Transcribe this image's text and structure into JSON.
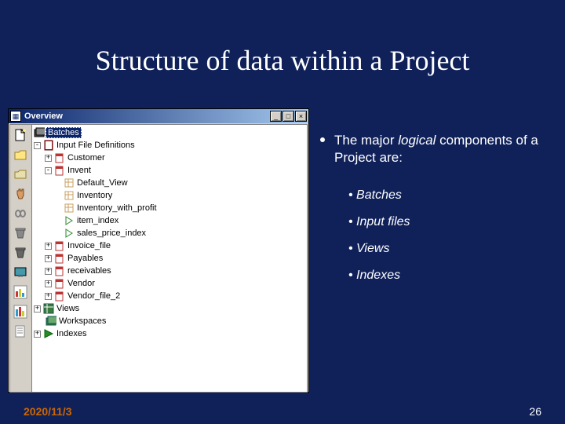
{
  "slide": {
    "title": "Structure of data within a Project",
    "date": "2020/11/3",
    "page_number": "26"
  },
  "overview_window": {
    "title": "Overview",
    "buttons": {
      "minimize": "_",
      "maximize": "□",
      "close": "×"
    }
  },
  "toolbar_icons": [
    "new-file-icon",
    "open-folder-icon",
    "folder-icon",
    "hand-icon",
    "link-icon",
    "bin-icon",
    "trash-icon",
    "monitor-icon",
    "bar-chart-icon",
    "column-chart-icon",
    "report-icon"
  ],
  "tree": {
    "root": "Batches",
    "ifd": "Input File Definitions",
    "customer": "Customer",
    "invent": "Invent",
    "invent_children": [
      "Default_View",
      "Inventory",
      "Inventory_with_profit",
      "item_index",
      "sales_price_index"
    ],
    "siblings": [
      "Invoice_file",
      "Payables",
      "receivables",
      "Vendor",
      "Vendor_file_2"
    ],
    "bottom": [
      "Views",
      "Workspaces",
      "Indexes"
    ]
  },
  "bullets": {
    "main_prefix": "The major ",
    "main_italic": "logical",
    "main_suffix": " components of a Project are:",
    "sub": [
      "Batches",
      "Input files",
      "Views",
      "Indexes"
    ]
  },
  "colors": {
    "background": "#10215a",
    "titlebar_start": "#0a246a",
    "date": "#cc6600"
  }
}
